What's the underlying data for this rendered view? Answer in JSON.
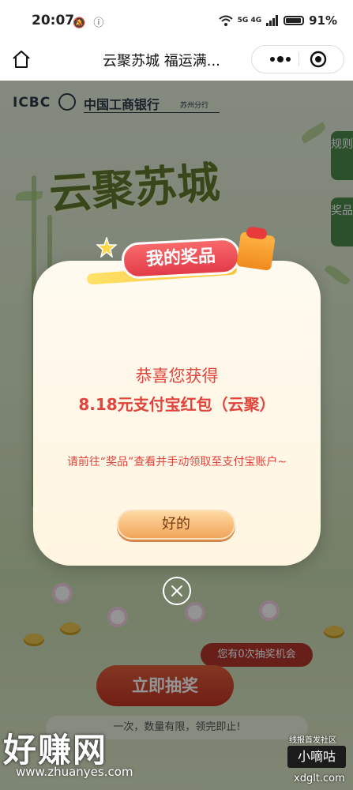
{
  "status_bar": {
    "time": "20:07",
    "icons": "🔕 ⓘ",
    "network": "5G 4G",
    "battery": "91%"
  },
  "nav": {
    "title": "云聚苏城 福运满...",
    "home_icon": "home-icon",
    "more_icon": "more-icon",
    "close_icon": "target-close-icon"
  },
  "page": {
    "logo_text": "ICBC",
    "bank_name": "中国工商银行",
    "branch": "苏州分行",
    "hero_title": "云聚苏城",
    "side_tabs": [
      "规则",
      "奖品"
    ],
    "chance_text": "您有0次抽奖机会",
    "draw_button": "立即抽奖",
    "notice": "一次，数量有限，领完即止!"
  },
  "modal": {
    "badge": "我的奖品",
    "congrats": "恭喜您获得",
    "prize": "8.18元支付宝红包（云聚）",
    "instruction": "请前往“奖品”查看并手动领取至支付宝账户~",
    "ok_button": "好的",
    "close_icon": "close-icon"
  },
  "watermark": {
    "left_title": "好赚网",
    "left_url": "www.zhuanyes.com",
    "right_top": "线报首发社区",
    "right_box": "小嘀咕",
    "right_url": "xdglt.com"
  },
  "colors": {
    "accent_red": "#e2443c",
    "button_red": "#c23424",
    "side_tab_green": "#4d8a4a"
  }
}
